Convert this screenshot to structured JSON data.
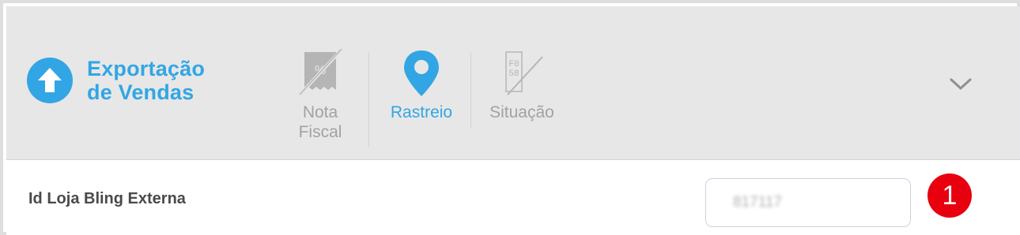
{
  "header": {
    "title_line1": "Exportação",
    "title_line2": "de Vendas",
    "steps": [
      {
        "label_line1": "Nota",
        "label_line2": "Fiscal",
        "state": "inactive",
        "icon": "receipt-percent-icon"
      },
      {
        "label_line1": "Rastreio",
        "label_line2": "",
        "state": "active",
        "icon": "map-pin-icon"
      },
      {
        "label_line1": "Situação",
        "label_line2": "",
        "state": "inactive",
        "icon": "status-tag-icon"
      }
    ],
    "collapse_icon": "chevron-down-icon"
  },
  "form": {
    "field_label": "Id Loja Bling Externa",
    "field_value": "817117"
  },
  "annotation": {
    "badge_number": "1"
  },
  "colors": {
    "accent": "#32a6e4",
    "inactive": "#a2a2a2",
    "header_bg": "#e7e7e7",
    "badge": "#e8000e"
  }
}
